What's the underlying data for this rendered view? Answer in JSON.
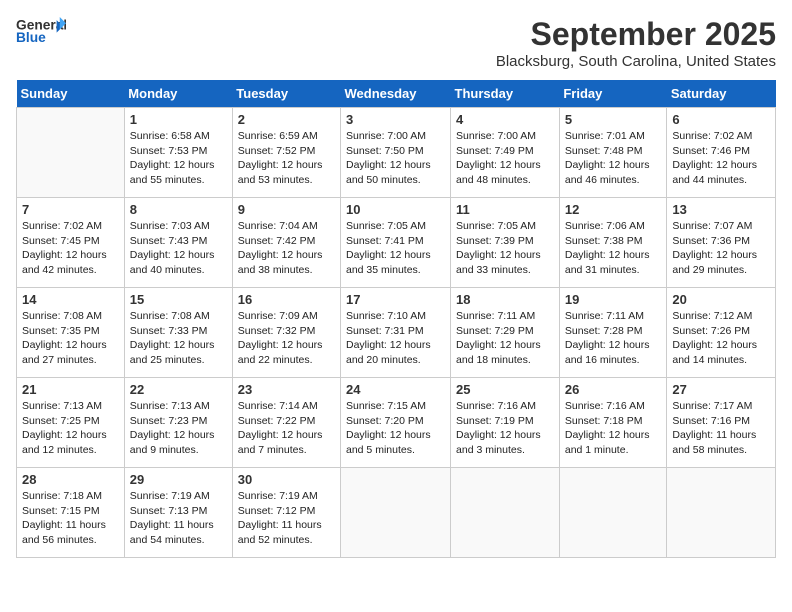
{
  "logo": {
    "line1": "General",
    "line2": "Blue"
  },
  "title": "September 2025",
  "location": "Blacksburg, South Carolina, United States",
  "weekdays": [
    "Sunday",
    "Monday",
    "Tuesday",
    "Wednesday",
    "Thursday",
    "Friday",
    "Saturday"
  ],
  "weeks": [
    [
      {
        "day": "",
        "info": ""
      },
      {
        "day": "1",
        "info": "Sunrise: 6:58 AM\nSunset: 7:53 PM\nDaylight: 12 hours\nand 55 minutes."
      },
      {
        "day": "2",
        "info": "Sunrise: 6:59 AM\nSunset: 7:52 PM\nDaylight: 12 hours\nand 53 minutes."
      },
      {
        "day": "3",
        "info": "Sunrise: 7:00 AM\nSunset: 7:50 PM\nDaylight: 12 hours\nand 50 minutes."
      },
      {
        "day": "4",
        "info": "Sunrise: 7:00 AM\nSunset: 7:49 PM\nDaylight: 12 hours\nand 48 minutes."
      },
      {
        "day": "5",
        "info": "Sunrise: 7:01 AM\nSunset: 7:48 PM\nDaylight: 12 hours\nand 46 minutes."
      },
      {
        "day": "6",
        "info": "Sunrise: 7:02 AM\nSunset: 7:46 PM\nDaylight: 12 hours\nand 44 minutes."
      }
    ],
    [
      {
        "day": "7",
        "info": "Sunrise: 7:02 AM\nSunset: 7:45 PM\nDaylight: 12 hours\nand 42 minutes."
      },
      {
        "day": "8",
        "info": "Sunrise: 7:03 AM\nSunset: 7:43 PM\nDaylight: 12 hours\nand 40 minutes."
      },
      {
        "day": "9",
        "info": "Sunrise: 7:04 AM\nSunset: 7:42 PM\nDaylight: 12 hours\nand 38 minutes."
      },
      {
        "day": "10",
        "info": "Sunrise: 7:05 AM\nSunset: 7:41 PM\nDaylight: 12 hours\nand 35 minutes."
      },
      {
        "day": "11",
        "info": "Sunrise: 7:05 AM\nSunset: 7:39 PM\nDaylight: 12 hours\nand 33 minutes."
      },
      {
        "day": "12",
        "info": "Sunrise: 7:06 AM\nSunset: 7:38 PM\nDaylight: 12 hours\nand 31 minutes."
      },
      {
        "day": "13",
        "info": "Sunrise: 7:07 AM\nSunset: 7:36 PM\nDaylight: 12 hours\nand 29 minutes."
      }
    ],
    [
      {
        "day": "14",
        "info": "Sunrise: 7:08 AM\nSunset: 7:35 PM\nDaylight: 12 hours\nand 27 minutes."
      },
      {
        "day": "15",
        "info": "Sunrise: 7:08 AM\nSunset: 7:33 PM\nDaylight: 12 hours\nand 25 minutes."
      },
      {
        "day": "16",
        "info": "Sunrise: 7:09 AM\nSunset: 7:32 PM\nDaylight: 12 hours\nand 22 minutes."
      },
      {
        "day": "17",
        "info": "Sunrise: 7:10 AM\nSunset: 7:31 PM\nDaylight: 12 hours\nand 20 minutes."
      },
      {
        "day": "18",
        "info": "Sunrise: 7:11 AM\nSunset: 7:29 PM\nDaylight: 12 hours\nand 18 minutes."
      },
      {
        "day": "19",
        "info": "Sunrise: 7:11 AM\nSunset: 7:28 PM\nDaylight: 12 hours\nand 16 minutes."
      },
      {
        "day": "20",
        "info": "Sunrise: 7:12 AM\nSunset: 7:26 PM\nDaylight: 12 hours\nand 14 minutes."
      }
    ],
    [
      {
        "day": "21",
        "info": "Sunrise: 7:13 AM\nSunset: 7:25 PM\nDaylight: 12 hours\nand 12 minutes."
      },
      {
        "day": "22",
        "info": "Sunrise: 7:13 AM\nSunset: 7:23 PM\nDaylight: 12 hours\nand 9 minutes."
      },
      {
        "day": "23",
        "info": "Sunrise: 7:14 AM\nSunset: 7:22 PM\nDaylight: 12 hours\nand 7 minutes."
      },
      {
        "day": "24",
        "info": "Sunrise: 7:15 AM\nSunset: 7:20 PM\nDaylight: 12 hours\nand 5 minutes."
      },
      {
        "day": "25",
        "info": "Sunrise: 7:16 AM\nSunset: 7:19 PM\nDaylight: 12 hours\nand 3 minutes."
      },
      {
        "day": "26",
        "info": "Sunrise: 7:16 AM\nSunset: 7:18 PM\nDaylight: 12 hours\nand 1 minute."
      },
      {
        "day": "27",
        "info": "Sunrise: 7:17 AM\nSunset: 7:16 PM\nDaylight: 11 hours\nand 58 minutes."
      }
    ],
    [
      {
        "day": "28",
        "info": "Sunrise: 7:18 AM\nSunset: 7:15 PM\nDaylight: 11 hours\nand 56 minutes."
      },
      {
        "day": "29",
        "info": "Sunrise: 7:19 AM\nSunset: 7:13 PM\nDaylight: 11 hours\nand 54 minutes."
      },
      {
        "day": "30",
        "info": "Sunrise: 7:19 AM\nSunset: 7:12 PM\nDaylight: 11 hours\nand 52 minutes."
      },
      {
        "day": "",
        "info": ""
      },
      {
        "day": "",
        "info": ""
      },
      {
        "day": "",
        "info": ""
      },
      {
        "day": "",
        "info": ""
      }
    ]
  ]
}
